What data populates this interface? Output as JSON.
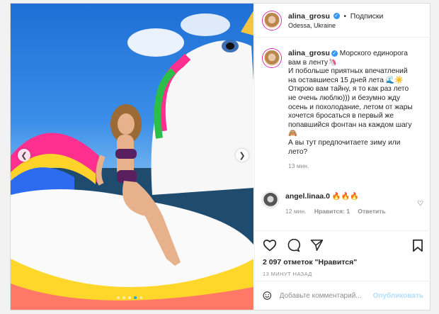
{
  "post": {
    "username": "alina_grosu",
    "follow_separator": "•",
    "follow_label": "Подписки",
    "location": "Odessa, Ukraine",
    "more_icon": "more-horizontal-icon"
  },
  "caption": {
    "lines": [
      "Морского единорога",
      "вам в ленту🦄",
      "И побольше приятных впечатлений",
      "на оставшиеся 15 дней лета 🌊☀️",
      "Открою вам тайну, я то как раз лето",
      "не очень люблю))) и безумно жду",
      "осень и похолодание, летом от жары",
      "хочется бросаться в первый же",
      "попавшийся фонтан на каждом шагу",
      "🙈",
      "А вы тут предпочитаете зиму или",
      "лето?"
    ],
    "time": "13 мин."
  },
  "comment": {
    "username": "angel.linaa.0",
    "text": "🔥🔥🔥",
    "time": "12 мин.",
    "likes": "Нравится: 1",
    "reply": "Ответить"
  },
  "actions": {
    "likes_text": "2 097 отметок \"Нравится\"",
    "time_ago": "13 МИНУТ НАЗАД"
  },
  "add_comment": {
    "placeholder": "Добавьте комментарий...",
    "publish": "Опубликовать"
  },
  "carousel": {
    "slides": 5,
    "active_index": 3
  },
  "colors": {
    "verified": "#3897f0",
    "link_disabled": "#b2dffc",
    "muted": "#8e8e8e"
  }
}
